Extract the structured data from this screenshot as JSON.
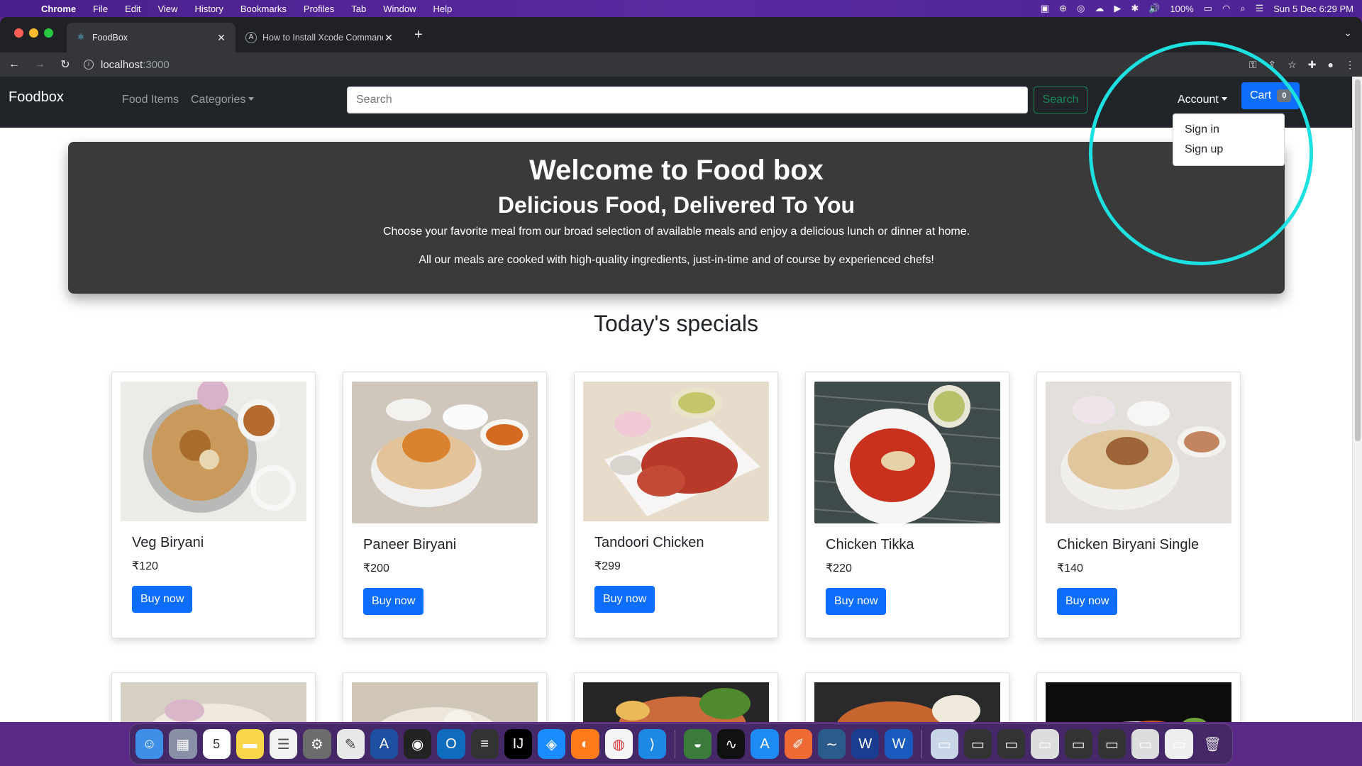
{
  "menubar": {
    "app": "Chrome",
    "items": [
      "File",
      "Edit",
      "View",
      "History",
      "Bookmarks",
      "Profiles",
      "Tab",
      "Window",
      "Help"
    ],
    "battery": "100%",
    "datetime": "Sun 5 Dec  6:29 PM"
  },
  "browser": {
    "tabs": [
      {
        "title": "FoodBox",
        "active": true
      },
      {
        "title": "How to Install Xcode Command",
        "active": false
      }
    ],
    "url_host": "localhost",
    "url_port": ":3000"
  },
  "nav": {
    "brand": "Foodbox",
    "food_items": "Food Items",
    "categories": "Categories",
    "search_placeholder": "Search",
    "search_button": "Search",
    "account": "Account",
    "cart_label": "Cart",
    "cart_count": "0"
  },
  "account_menu": {
    "sign_in": "Sign in",
    "sign_up": "Sign up"
  },
  "hero": {
    "title": "Welcome to Food box",
    "subtitle": "Delicious Food, Delivered To You",
    "line1": "Choose your favorite meal from our broad selection of available meals and enjoy a delicious lunch or dinner at home.",
    "line2": "All our meals are cooked with high-quality ingredients, just-in-time and of course by experienced chefs!"
  },
  "specials_heading": "Today's specials",
  "products": [
    {
      "name": "Veg Biryani",
      "price": "₹120",
      "buy": "Buy now"
    },
    {
      "name": "Paneer Biryani",
      "price": "₹200",
      "buy": "Buy now"
    },
    {
      "name": "Tandoori Chicken",
      "price": "₹299",
      "buy": "Buy now"
    },
    {
      "name": "Chicken Tikka",
      "price": "₹220",
      "buy": "Buy now"
    },
    {
      "name": "Chicken Biryani Single",
      "price": "₹140",
      "buy": "Buy now"
    }
  ],
  "colors": {
    "navbar": "#212529",
    "primary": "#0d6efd",
    "success": "#198754",
    "hero_bg": "#3a3a3a",
    "annotation": "#1de0e0"
  }
}
